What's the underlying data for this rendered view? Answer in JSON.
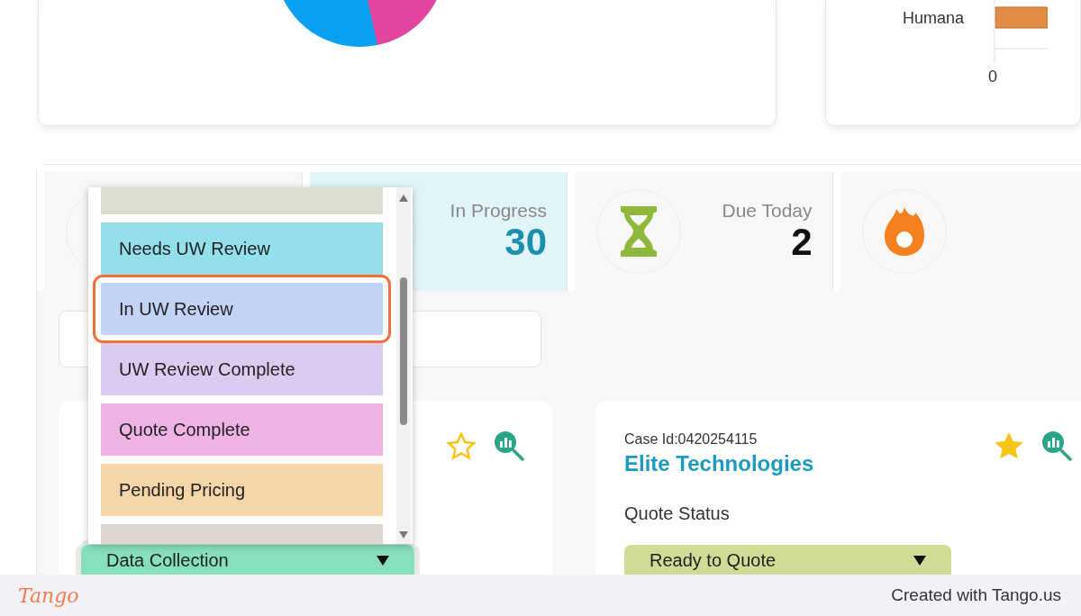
{
  "top_cards": [
    {
      "kind": "pie"
    },
    {
      "kind": "bar",
      "category_label": "Humana",
      "axis_tick": "0"
    }
  ],
  "stat_tiles": [
    {
      "kind": "pill",
      "selected": false
    },
    {
      "kind": "stack",
      "label": "In Progress",
      "count": "30",
      "selected": true
    },
    {
      "kind": "hourglass",
      "label": "Due Today",
      "count": "2",
      "selected": false
    },
    {
      "kind": "flame",
      "selected": false
    }
  ],
  "cases": [
    {
      "favorite": false,
      "status": "Data Collection",
      "color": "#86e0bc"
    },
    {
      "case_id": "Case Id:0420254115",
      "name": "Elite Technologies",
      "status_label": "Quote Status",
      "status": "Ready to Quote",
      "favorite": true,
      "color": "#d0dc96"
    }
  ],
  "status_dropdown": {
    "options": [
      {
        "color": "#dcdfd0",
        "selected": false
      },
      {
        "label": "Needs UW Review",
        "color": "#93e0ec",
        "selected": false
      },
      {
        "label": "In UW Review",
        "color": "#c3d3f5",
        "selected": true
      },
      {
        "label": "UW Review Complete",
        "color": "#dccbf0",
        "selected": false
      },
      {
        "label": "Quote Complete",
        "color": "#f0b3e6",
        "selected": false
      },
      {
        "label": "Pending Pricing",
        "color": "#f5d6a8",
        "selected": false
      },
      {
        "color": "#ddd5d0",
        "selected": false
      }
    ]
  },
  "footer": {
    "logo": "Tango",
    "credit": "Created with Tango.us"
  }
}
